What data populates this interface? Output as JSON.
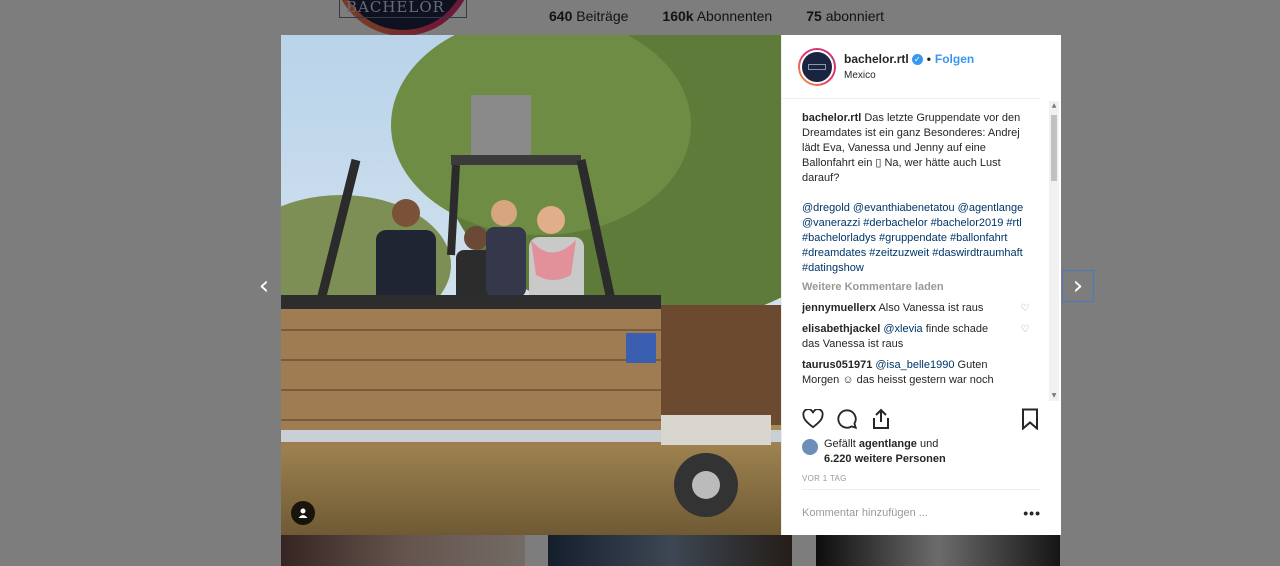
{
  "profile_bg": {
    "logo_text": "DER BACHELOR",
    "stats": [
      {
        "value": "640",
        "label": "Beiträge"
      },
      {
        "value": "160k",
        "label": "Abonnenten"
      },
      {
        "value": "75",
        "label": "abonniert"
      }
    ]
  },
  "nav": {
    "prev": "‹",
    "next": "›"
  },
  "post": {
    "username": "bachelor.rtl",
    "dot": "•",
    "follow_label": "Folgen",
    "location": "Mexico",
    "caption_user": "bachelor.rtl",
    "caption_text": "Das letzte Gruppendate vor den Dreamdates ist ein ganz Besonderes: Andrej lädt Eva, Vanessa und Jenny auf eine Ballonfahrt ein ▯ Na, wer hätte auch Lust darauf?",
    "hashtags": "@dregold @evanthiabenetatou @agentlange @vanerazzi #derbachelor #bachelor2019 #rtl #bachelorladys #gruppendate #ballonfahrt #dreamdates #zeitzuzweit #daswirdtraumhaft #datingshow",
    "load_more": "Weitere Kommentare laden",
    "comments": [
      {
        "user": "jennymuellerx",
        "mention": "",
        "text": "Also Vanessa ist raus"
      },
      {
        "user": "elisabethjackel",
        "mention": "@xlevia",
        "text": "finde schade das Vanessa ist raus"
      },
      {
        "user": "taurus051971",
        "mention": "@isa_belle1990",
        "text": "Guten Morgen ☺ das heisst gestern war noch"
      }
    ],
    "likes_prefix": "Gefällt",
    "likes_user": "agentlange",
    "likes_and": "und",
    "likes_count": "6.220 weitere Personen",
    "time_ago": "VOR 1 TAG",
    "comment_placeholder": "Kommentar hinzufügen ...",
    "options": "•••"
  },
  "colors": {
    "link": "#3897f0",
    "hashtag": "#003569",
    "muted": "#999999"
  }
}
